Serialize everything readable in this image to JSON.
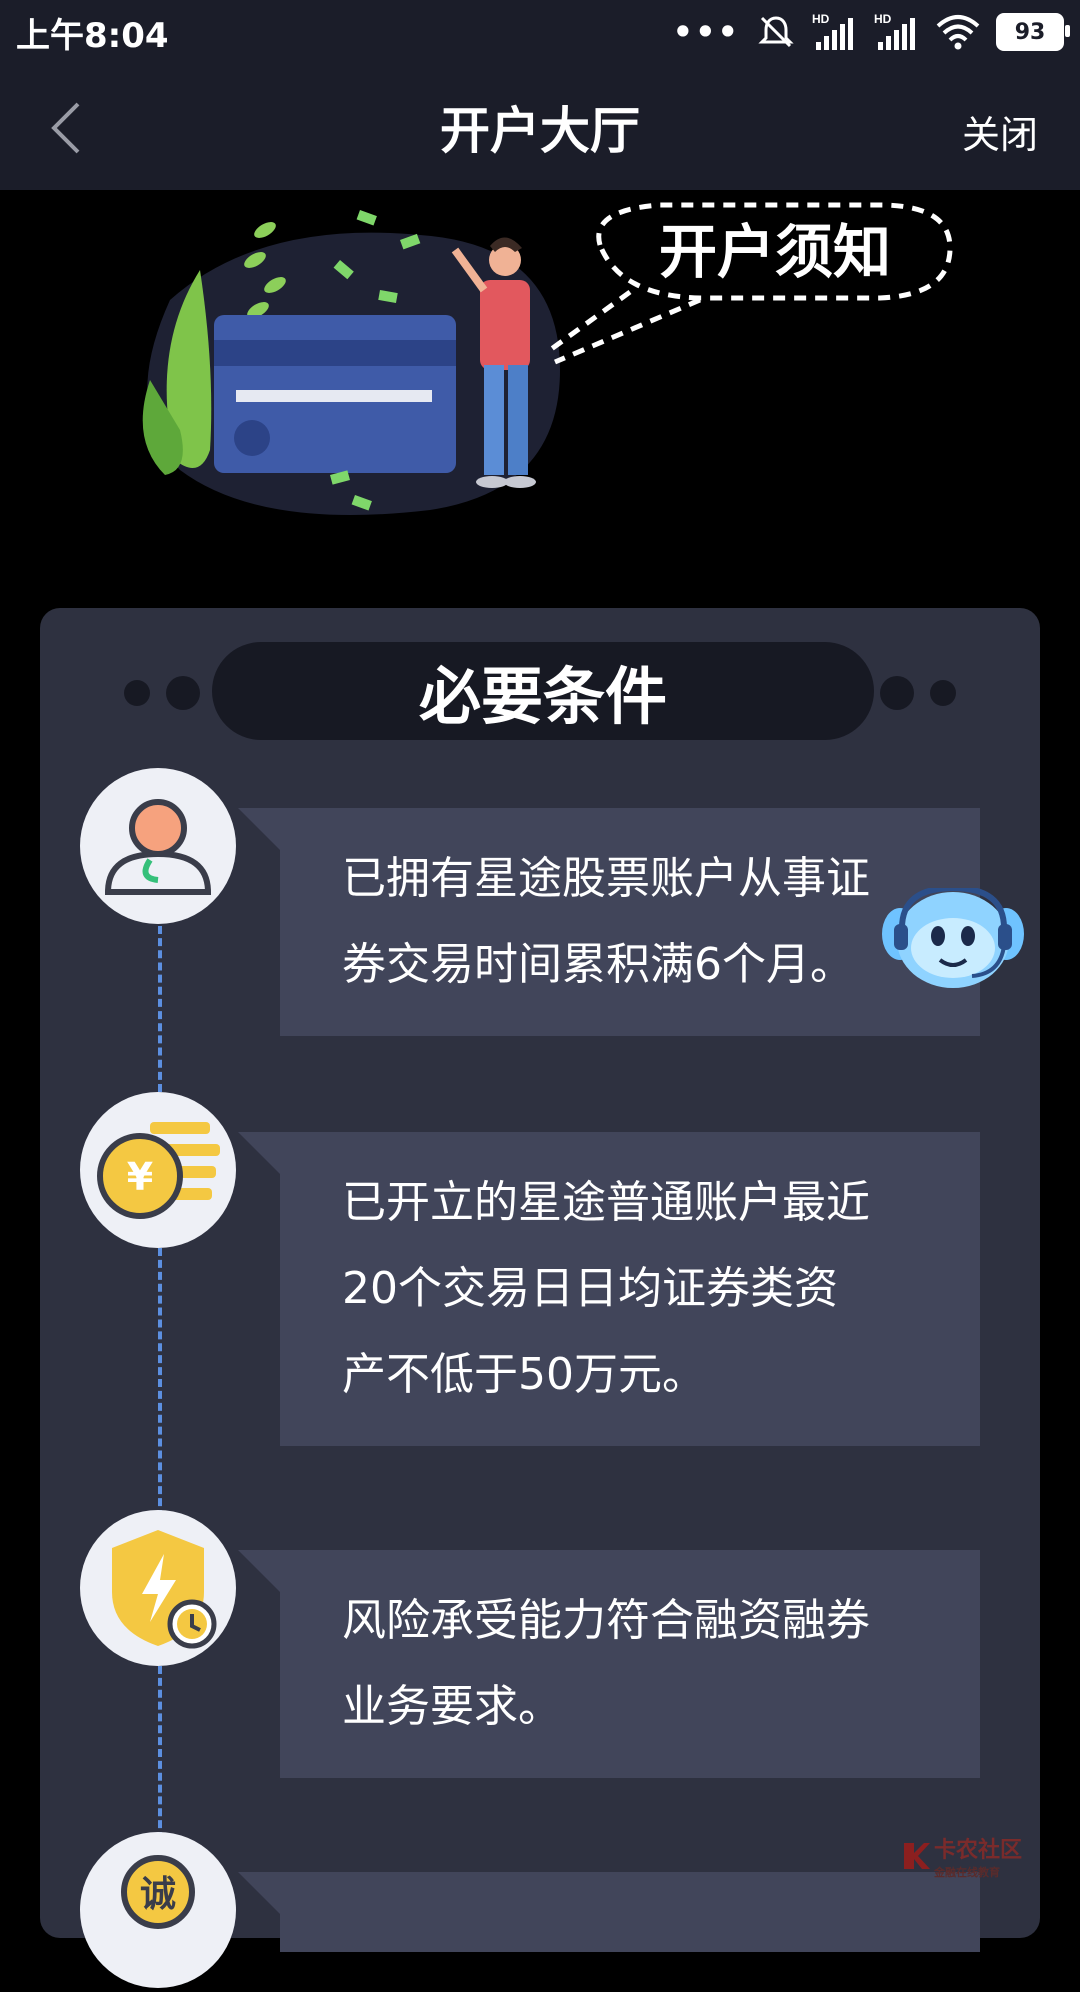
{
  "status_bar": {
    "time": "上午8:04",
    "more": "•••",
    "hd1": "HD",
    "hd2": "HD",
    "battery": "93"
  },
  "nav": {
    "title": "开户大厅",
    "close_label": "关闭"
  },
  "hero": {
    "bubble_text": "开户须知"
  },
  "section": {
    "title": "必要条件"
  },
  "conditions": [
    {
      "icon": "user-icon",
      "lines": [
        "已拥有星途股票账户从事证",
        "券交易时间累积满6个月。"
      ]
    },
    {
      "icon": "coin-icon",
      "coin_label": "¥",
      "lines": [
        "已开立的星途普通账户最近",
        "20个交易日日均证券类资",
        "产不低于50万元。"
      ]
    },
    {
      "icon": "risk-shield-icon",
      "lines": [
        "风险承受能力符合融资融券",
        "业务要求。"
      ]
    },
    {
      "icon": "honesty-icon",
      "badge": "诚",
      "lines": []
    }
  ],
  "watermark": {
    "text": "卡农社区",
    "sub": "金融在线教育"
  },
  "colors": {
    "bar_bg": "#1b1d29",
    "card_bg": "#2e3140",
    "item_bg": "#41455a",
    "pill_bg": "#171923",
    "timeline": "#5c8fe0",
    "icon_yellow": "#f4c842",
    "icon_orange": "#f6a27e"
  }
}
